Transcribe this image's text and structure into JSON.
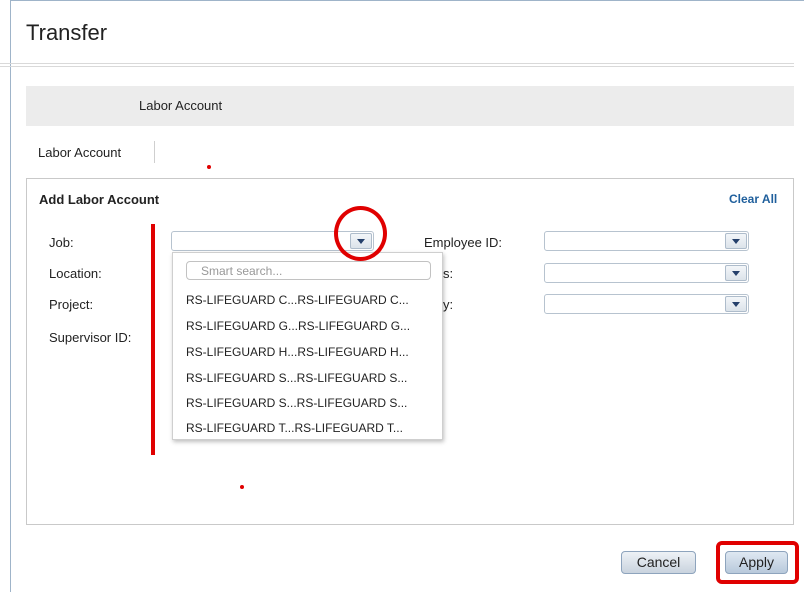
{
  "dialog": {
    "title": "Transfer"
  },
  "gray_bar": {
    "label": "Labor Account"
  },
  "tabs": [
    {
      "label": "Labor Account"
    }
  ],
  "panel": {
    "title": "Add Labor Account",
    "clear_all": "Clear All",
    "left_fields": [
      {
        "label": "Job:"
      },
      {
        "label": "Location:"
      },
      {
        "label": "Project:"
      },
      {
        "label": "Supervisor ID:"
      }
    ],
    "right_fields": [
      {
        "label": "Employee ID:"
      },
      {
        "label": "s:"
      },
      {
        "label": "y:"
      }
    ]
  },
  "dropdown": {
    "search_placeholder": "Smart search...",
    "items": [
      "RS-LIFEGUARD C...RS-LIFEGUARD C...",
      "RS-LIFEGUARD G...RS-LIFEGUARD G...",
      "RS-LIFEGUARD H...RS-LIFEGUARD H...",
      "RS-LIFEGUARD S...RS-LIFEGUARD S...",
      "RS-LIFEGUARD S...RS-LIFEGUARD S...",
      "RS-LIFEGUARD T...RS-LIFEGUARD T..."
    ]
  },
  "footer": {
    "cancel_label": "Cancel",
    "apply_label": "Apply"
  },
  "colors": {
    "annotation": "#e00000",
    "link": "#1f5f9c"
  },
  "icons": {
    "select_arrow": "chevron-down-icon"
  }
}
